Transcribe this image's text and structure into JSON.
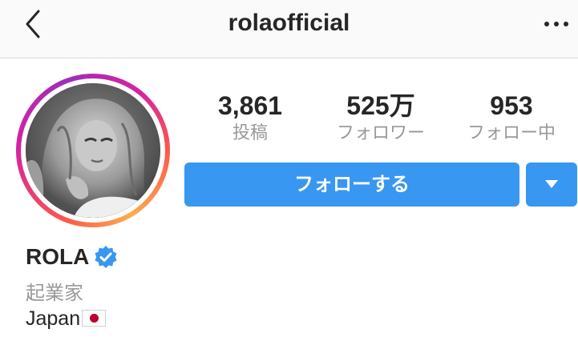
{
  "header": {
    "username": "rolaofficial",
    "back_icon": "chevron-left-icon",
    "more_icon": "more-horizontal-icon"
  },
  "profile": {
    "avatar": "profile-photo",
    "ring_colors": [
      "#fd5949",
      "#d6249f",
      "#a12dbb",
      "#fbad50"
    ],
    "stats": [
      {
        "value": "3,861",
        "label": "投稿"
      },
      {
        "value": "525万",
        "label": "フォロワー"
      },
      {
        "value": "953",
        "label": "フォロー中"
      }
    ],
    "follow_label": "フォローする",
    "dropdown_icon": "caret-down-icon",
    "accent_color": "#3897f0",
    "name": "ROLA",
    "verified_icon": "verified-badge-icon",
    "category": "起業家",
    "bio": "Japan",
    "bio_flag_icon": "japan-flag-icon"
  }
}
